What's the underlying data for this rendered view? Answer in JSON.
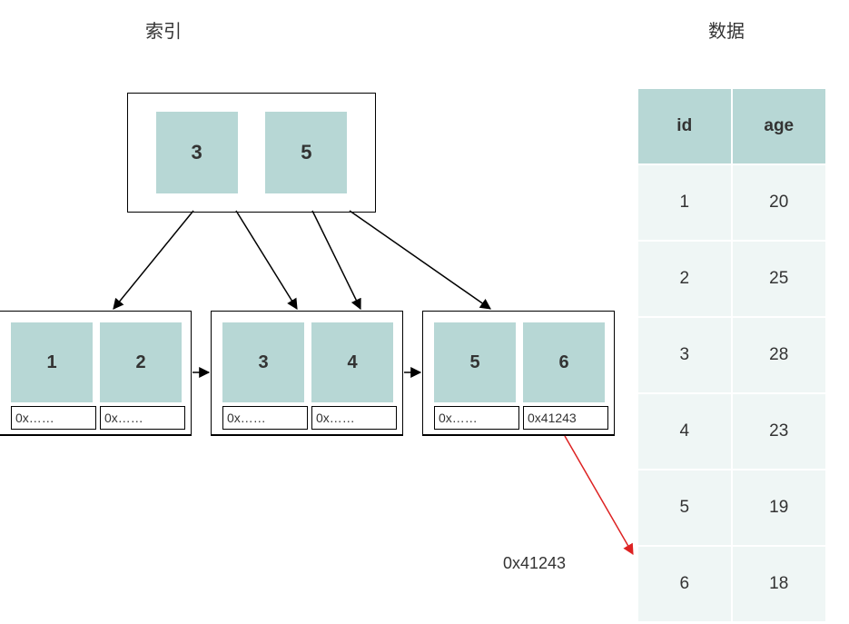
{
  "titles": {
    "index": "索引",
    "data": "数据"
  },
  "root": {
    "keys": [
      "3",
      "5"
    ]
  },
  "leaves": [
    {
      "keys": [
        "1",
        "2"
      ],
      "ptrs": [
        "0x……",
        "0x……"
      ]
    },
    {
      "keys": [
        "3",
        "4"
      ],
      "ptrs": [
        "0x……",
        "0x……"
      ]
    },
    {
      "keys": [
        "5",
        "6"
      ],
      "ptrs": [
        "0x……",
        "0x41243"
      ]
    }
  ],
  "table": {
    "headers": [
      "id",
      "age"
    ],
    "rows": [
      [
        "1",
        "20"
      ],
      [
        "2",
        "25"
      ],
      [
        "3",
        "28"
      ],
      [
        "4",
        "23"
      ],
      [
        "5",
        "19"
      ],
      [
        "6",
        "18"
      ]
    ]
  },
  "address_label": "0x41243",
  "chart_data": {
    "type": "table",
    "description": "B+Tree index diagram pointing to a data table",
    "index_tree": {
      "root_keys": [
        3,
        5
      ],
      "leaf_nodes": [
        {
          "keys": [
            1,
            2
          ],
          "pointers": [
            "0x……",
            "0x……"
          ]
        },
        {
          "keys": [
            3,
            4
          ],
          "pointers": [
            "0x……",
            "0x……"
          ]
        },
        {
          "keys": [
            5,
            6
          ],
          "pointers": [
            "0x……",
            "0x41243"
          ]
        }
      ]
    },
    "data_rows": [
      {
        "id": 1,
        "age": 20
      },
      {
        "id": 2,
        "age": 25
      },
      {
        "id": 3,
        "age": 28
      },
      {
        "id": 4,
        "age": 23
      },
      {
        "id": 5,
        "age": 19
      },
      {
        "id": 6,
        "age": 18
      }
    ],
    "highlighted_pointer": {
      "address": "0x41243",
      "targets_id": 6
    }
  }
}
